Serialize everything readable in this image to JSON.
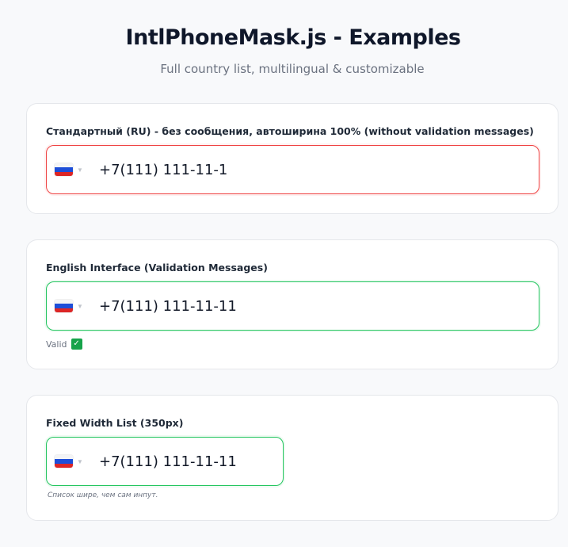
{
  "header": {
    "title": "IntlPhoneMask.js - Examples",
    "subtitle": "Full country list, multilingual & customizable"
  },
  "examples": [
    {
      "label": "Стандартный (RU) - без сообщения, автоширина 100% (without validation messages)",
      "phone_value": "+7(111) 111-11-1",
      "country_flag": "russia-flag-icon",
      "state": "invalid",
      "border_color": "#ef4444"
    },
    {
      "label": "English Interface (Validation Messages)",
      "phone_value": "+7(111) 111-11-11",
      "country_flag": "russia-flag-icon",
      "state": "valid",
      "border_color": "#22c55e",
      "message": "Valid",
      "message_icon": "check-icon"
    },
    {
      "label": "Fixed Width List (350px)",
      "phone_value": "+7(111) 111-11-11",
      "country_flag": "russia-flag-icon",
      "state": "valid",
      "border_color": "#22c55e",
      "hint": "Список шире, чем сам инпут."
    }
  ],
  "colors": {
    "valid": "#22c55e",
    "invalid": "#ef4444",
    "check_bg": "#16a34a"
  }
}
